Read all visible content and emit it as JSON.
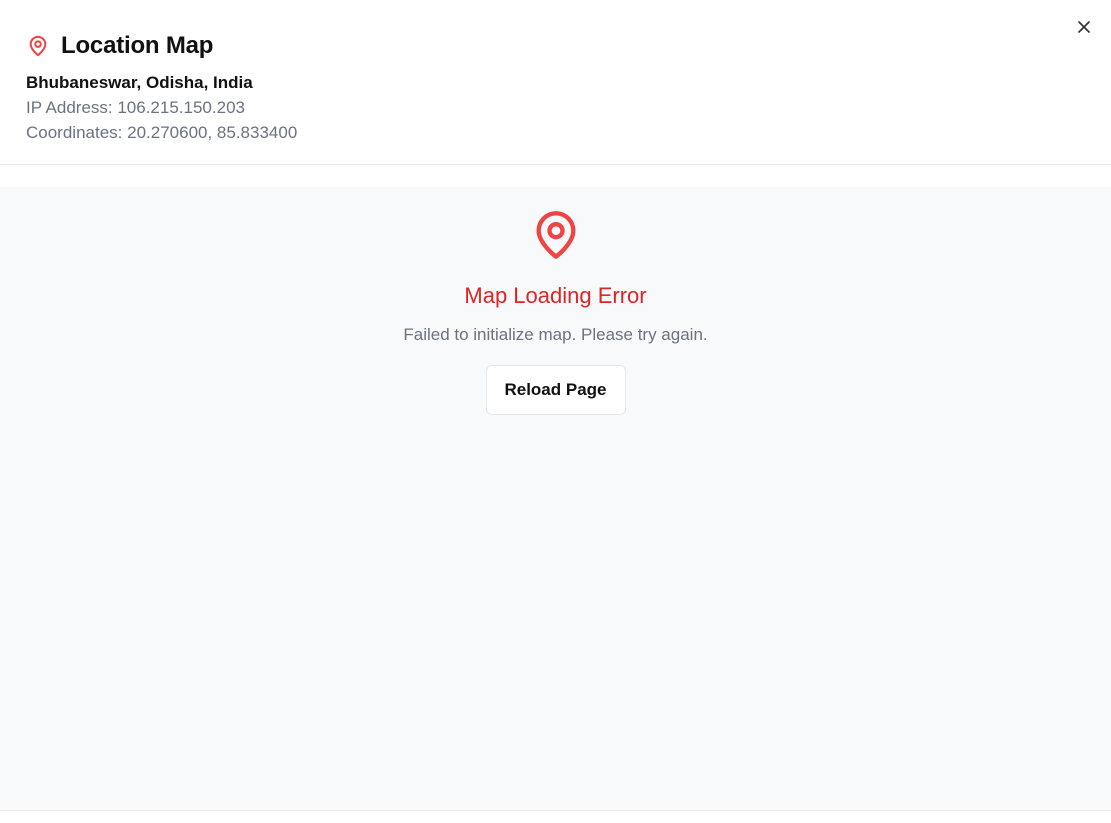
{
  "dialog": {
    "title": "Location Map",
    "title_icon": "map-pin-icon",
    "close_icon": "close-icon"
  },
  "location": {
    "name": "Bhubaneswar, Odisha, India",
    "ip_line": "IP Address: 106.215.150.203",
    "coords_line": "Coordinates: 20.270600, 85.833400"
  },
  "map": {
    "error_icon": "map-pin-icon",
    "error_title": "Map Loading Error",
    "error_message": "Failed to initialize map. Please try again.",
    "reload_label": "Reload Page"
  },
  "colors": {
    "accent_red": "#dc2626",
    "icon_red": "#ef4444",
    "muted_text": "#6b7280",
    "map_bg": "#f8f9fa"
  }
}
